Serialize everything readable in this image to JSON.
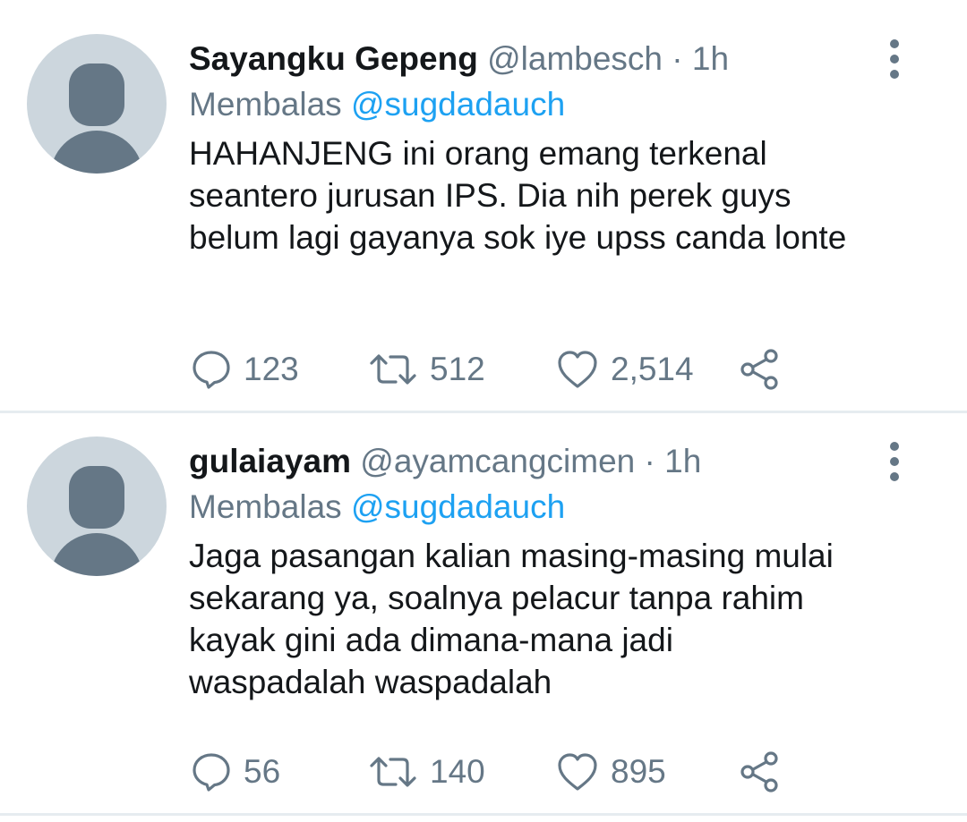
{
  "tweets": [
    {
      "name": "Sayangku Gepeng",
      "handle": "@lambesch",
      "separator": "·",
      "time": "1h",
      "reply_prefix": "Membalas",
      "reply_to": "@sugdadauch",
      "text": "HAHANJENG ini orang emang terkenal seantero jurusan IPS. Dia nih perek guys belum lagi gayanya sok iye upss canda lonte",
      "replies": "123",
      "retweets": "512",
      "likes": "2,514"
    },
    {
      "name": "gulaiayam",
      "handle": "@ayamcangcimen",
      "separator": "·",
      "time": "1h",
      "reply_prefix": "Membalas",
      "reply_to": "@sugdadauch",
      "text": "Jaga pasangan kalian masing-masing mulai sekarang ya, soalnya pelacur tanpa rahim kayak gini ada dimana-mana jadi waspadalah waspadalah",
      "replies": "56",
      "retweets": "140",
      "likes": "895"
    }
  ],
  "icons": {
    "avatar": "default-avatar-icon",
    "more": "more-vertical-icon",
    "reply": "reply-bubble-icon",
    "retweet": "retweet-icon",
    "like": "heart-icon",
    "share": "share-icon"
  },
  "colors": {
    "text": "#14171a",
    "secondary": "#657786",
    "accent": "#1da1f2",
    "avatar_bg": "#ccd6dd",
    "divider": "#e6ecf0"
  }
}
